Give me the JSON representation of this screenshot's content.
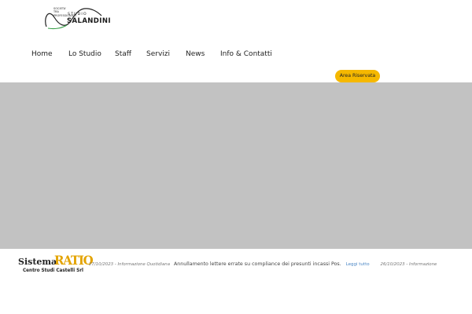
{
  "logo": {
    "tagline": [
      "SOCIETA'",
      "TRA",
      "PROFESSIONISTI"
    ],
    "studio": "STUDIO",
    "name": "SALANDINI"
  },
  "nav": {
    "items": [
      {
        "label": "Home"
      },
      {
        "label": "Lo Studio"
      },
      {
        "label": "Staff"
      },
      {
        "label": "Servizi"
      },
      {
        "label": "News"
      },
      {
        "label": "Info & Contatti"
      }
    ]
  },
  "area_riservata": {
    "label": "Area Riservata",
    "color": "#f5b800"
  },
  "hero": {
    "color": "#c2c2c2"
  },
  "footer": {
    "ratio_logo": {
      "sistema": "Sistema",
      "ratio": "RATIO",
      "company": "Centro Studi Castelli Srl"
    },
    "ticker": [
      {
        "date": "27/10/2023 - Informazione Quotidiana",
        "headline": "Annullamento lettere errate su compliance dei presunti incassi Pos.",
        "more": "Leggi tutto"
      },
      {
        "date": "26/10/2023 - Informazione"
      }
    ]
  }
}
